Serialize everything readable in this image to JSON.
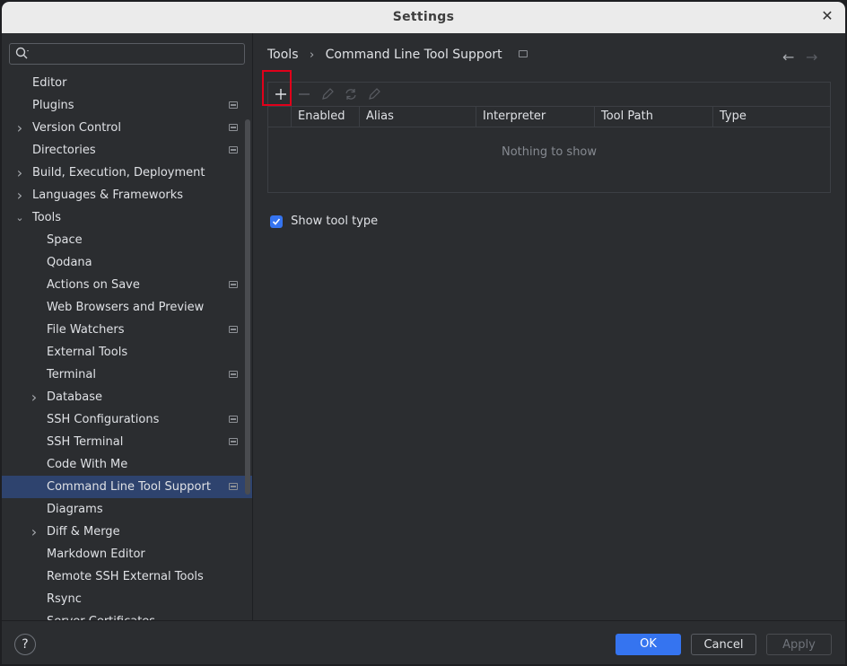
{
  "window": {
    "title": "Settings"
  },
  "search": {
    "placeholder": ""
  },
  "sidebar": {
    "items": [
      {
        "label": "Editor",
        "level": 0,
        "arrow": "",
        "pinned": false,
        "selected": false
      },
      {
        "label": "Plugins",
        "level": 0,
        "arrow": "",
        "pinned": true,
        "selected": false
      },
      {
        "label": "Version Control",
        "level": 0,
        "arrow": "right",
        "pinned": true,
        "selected": false
      },
      {
        "label": "Directories",
        "level": 0,
        "arrow": "",
        "pinned": true,
        "selected": false
      },
      {
        "label": "Build, Execution, Deployment",
        "level": 0,
        "arrow": "right",
        "pinned": false,
        "selected": false
      },
      {
        "label": "Languages & Frameworks",
        "level": 0,
        "arrow": "right",
        "pinned": false,
        "selected": false
      },
      {
        "label": "Tools",
        "level": 0,
        "arrow": "down",
        "pinned": false,
        "selected": false
      },
      {
        "label": "Space",
        "level": 1,
        "arrow": "",
        "pinned": false,
        "selected": false
      },
      {
        "label": "Qodana",
        "level": 1,
        "arrow": "",
        "pinned": false,
        "selected": false
      },
      {
        "label": "Actions on Save",
        "level": 1,
        "arrow": "",
        "pinned": true,
        "selected": false
      },
      {
        "label": "Web Browsers and Preview",
        "level": 1,
        "arrow": "",
        "pinned": false,
        "selected": false
      },
      {
        "label": "File Watchers",
        "level": 1,
        "arrow": "",
        "pinned": true,
        "selected": false
      },
      {
        "label": "External Tools",
        "level": 1,
        "arrow": "",
        "pinned": false,
        "selected": false
      },
      {
        "label": "Terminal",
        "level": 1,
        "arrow": "",
        "pinned": true,
        "selected": false
      },
      {
        "label": "Database",
        "level": 1,
        "arrow": "right",
        "pinned": false,
        "selected": false
      },
      {
        "label": "SSH Configurations",
        "level": 1,
        "arrow": "",
        "pinned": true,
        "selected": false
      },
      {
        "label": "SSH Terminal",
        "level": 1,
        "arrow": "",
        "pinned": true,
        "selected": false
      },
      {
        "label": "Code With Me",
        "level": 1,
        "arrow": "",
        "pinned": false,
        "selected": false
      },
      {
        "label": "Command Line Tool Support",
        "level": 1,
        "arrow": "",
        "pinned": true,
        "selected": true
      },
      {
        "label": "Diagrams",
        "level": 1,
        "arrow": "",
        "pinned": false,
        "selected": false
      },
      {
        "label": "Diff & Merge",
        "level": 1,
        "arrow": "right",
        "pinned": false,
        "selected": false
      },
      {
        "label": "Markdown Editor",
        "level": 1,
        "arrow": "",
        "pinned": false,
        "selected": false
      },
      {
        "label": "Remote SSH External Tools",
        "level": 1,
        "arrow": "",
        "pinned": false,
        "selected": false
      },
      {
        "label": "Rsync",
        "level": 1,
        "arrow": "",
        "pinned": false,
        "selected": false
      },
      {
        "label": "Server Certificates",
        "level": 1,
        "arrow": "",
        "pinned": false,
        "selected": false
      }
    ]
  },
  "breadcrumb": {
    "parent": "Tools",
    "separator": "›",
    "current": "Command Line Tool Support"
  },
  "nav": {
    "back_icon": "arrow-left-icon",
    "forward_icon": "arrow-right-icon"
  },
  "toolbar": {
    "buttons": [
      "add-icon",
      "remove-icon",
      "edit-icon",
      "refresh-icon",
      "edit-alias-icon"
    ]
  },
  "table": {
    "columns": [
      "Enabled",
      "Alias",
      "Interpreter",
      "Tool Path",
      "Type"
    ],
    "empty_text": "Nothing to show"
  },
  "options": {
    "show_tool_type_label": "Show tool type",
    "show_tool_type_checked": true
  },
  "footer": {
    "help": "?",
    "ok": "OK",
    "cancel": "Cancel",
    "apply": "Apply"
  },
  "colors": {
    "accent": "#3574f0",
    "selection": "#2e436e",
    "highlight_box": "#e0001a"
  }
}
